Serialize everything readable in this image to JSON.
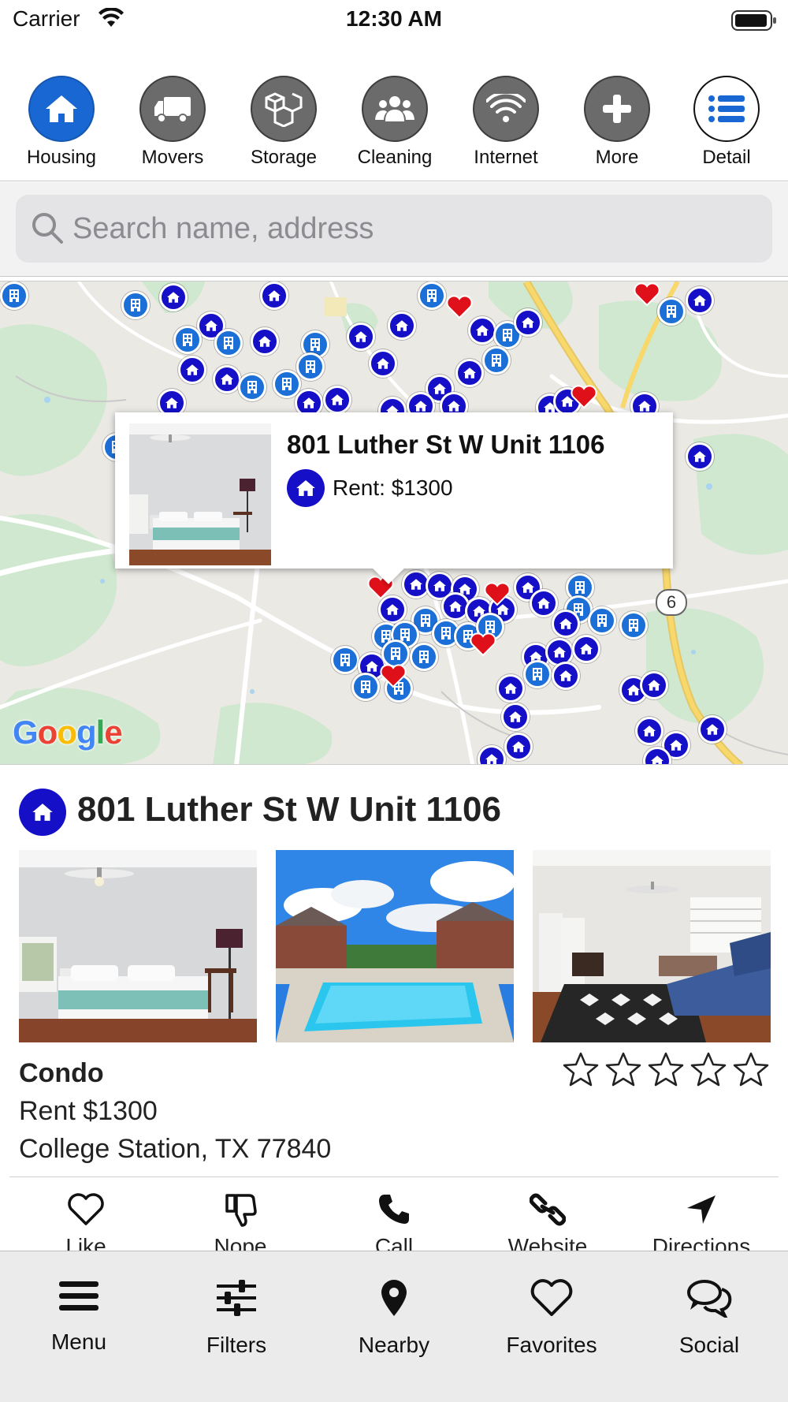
{
  "status_bar": {
    "carrier": "Carrier",
    "time": "12:30 AM"
  },
  "categories": [
    {
      "label": "Housing",
      "icon": "house-icon",
      "active": true
    },
    {
      "label": "Movers",
      "icon": "truck-icon"
    },
    {
      "label": "Storage",
      "icon": "boxes-icon"
    },
    {
      "label": "Cleaning",
      "icon": "people-icon"
    },
    {
      "label": "Internet",
      "icon": "wifi-icon"
    },
    {
      "label": "More",
      "icon": "plus-icon"
    },
    {
      "label": "Detail",
      "icon": "list-icon"
    }
  ],
  "search": {
    "placeholder": "Search name, address"
  },
  "map": {
    "popup": {
      "title": "801 Luther St W Unit 1106",
      "rent": "Rent: $1300"
    },
    "route_number": "6",
    "provider": "Google",
    "colors": {
      "housing_marker": "#1510c8",
      "building_marker": "#1d6fd8",
      "favorite_marker": "#e0101a"
    }
  },
  "detail": {
    "title": "801 Luther St W Unit 1106",
    "type": "Condo",
    "rent": "Rent $1300",
    "location": "College Station, TX 77840",
    "rating": 0,
    "photos": [
      "bedroom-photo",
      "pool-photo",
      "living-room-photo"
    ],
    "actions": [
      {
        "label": "Like",
        "icon": "heart-outline-icon"
      },
      {
        "label": "Nope",
        "icon": "thumbs-down-icon"
      },
      {
        "label": "Call",
        "icon": "phone-icon"
      },
      {
        "label": "Website",
        "icon": "link-icon"
      },
      {
        "label": "Directions",
        "icon": "navigation-arrow-icon"
      }
    ]
  },
  "tabbar": [
    {
      "label": "Menu",
      "icon": "hamburger-icon"
    },
    {
      "label": "Filters",
      "icon": "sliders-icon"
    },
    {
      "label": "Nearby",
      "icon": "location-pin-icon"
    },
    {
      "label": "Favorites",
      "icon": "heart-icon"
    },
    {
      "label": "Social",
      "icon": "chat-bubbles-icon"
    }
  ]
}
